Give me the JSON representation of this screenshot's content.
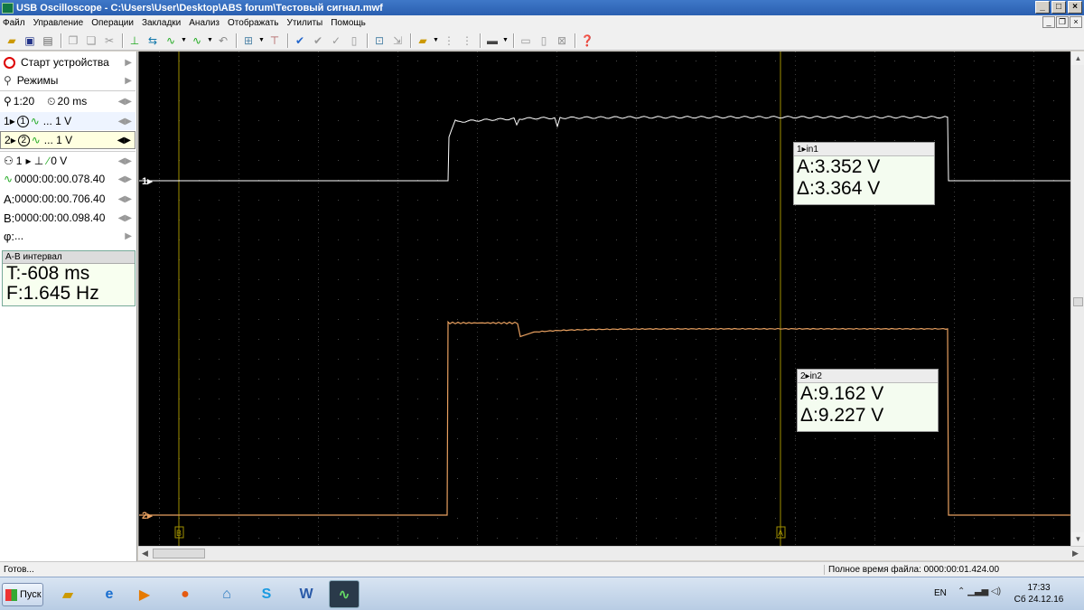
{
  "window": {
    "title": "USB Oscilloscope - C:\\Users\\User\\Desktop\\ABS forum\\Тестовый сигнал.mwf",
    "min": "_",
    "max": "□",
    "close": "×"
  },
  "menu": [
    "Файл",
    "Управление",
    "Операции",
    "Закладки",
    "Анализ",
    "Отображать",
    "Утилиты",
    "Помощь"
  ],
  "left_panel": {
    "start_device": "Старт устройства",
    "modes": "Режимы",
    "scale": "1:20",
    "timebase": "20 ms",
    "ch1": {
      "num": "1",
      "circle": "1",
      "value": "... 1 V"
    },
    "ch2": {
      "num": "2",
      "circle": "2",
      "value": "... 1 V"
    },
    "trigger": {
      "ch": "1",
      "level": "0 V"
    },
    "pos_time": "0000:00:00.078.40",
    "cursor_a": {
      "label": "A:",
      "time": "0000:00:00.706.40"
    },
    "cursor_b": {
      "label": "B:",
      "time": "0000:00:00.098.40"
    },
    "phi": {
      "label": "φ:",
      "value": "..."
    }
  },
  "ab_interval": {
    "header": "A-B интервал",
    "T": "T:-608 ms",
    "F": "F:1.645 Hz"
  },
  "scope": {
    "bg": "#000000",
    "grid_color": "#4a4a4a",
    "ch1_color": "#ffffff",
    "ch2_color": "#e8a060",
    "cursor_color": "#a09000",
    "ch1_marker": "1",
    "ch2_marker": "2",
    "cursor_a_tag": "A",
    "cursor_b_tag": "B",
    "ch1_low_V": 0,
    "ch1_high_V": 3.35,
    "ch2_low_V": 0,
    "ch2_high_V": 9.16
  },
  "meas1": {
    "header": "1▸in1",
    "a": "A:3.352 V",
    "d": "Δ:3.364 V"
  },
  "meas2": {
    "header": "2▸in2",
    "a": "A:9.162 V",
    "d": "Δ:9.227 V"
  },
  "status": {
    "left": "Готов...",
    "right": "Полное время файла: 0000:00:01.424.00"
  },
  "taskbar": {
    "start": "Пуск",
    "lang": "EN",
    "time": "17:33",
    "date": "Сб 24.12.16"
  }
}
